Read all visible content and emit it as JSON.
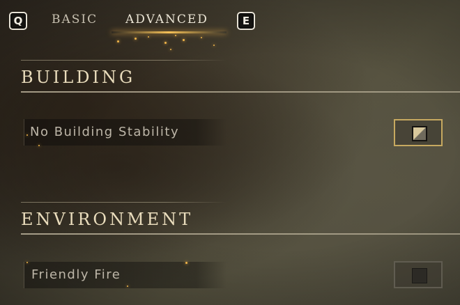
{
  "tabs": {
    "prev_key": "Q",
    "next_key": "E",
    "items": [
      {
        "label": "BASIC",
        "active": false
      },
      {
        "label": "ADVANCED",
        "active": true
      }
    ]
  },
  "sections": [
    {
      "title": "BUILDING",
      "settings": [
        {
          "label": "No Building Stability",
          "checked": true
        }
      ]
    },
    {
      "title": "ENVIRONMENT",
      "settings": [
        {
          "label": "Friendly Fire",
          "checked": false
        }
      ]
    }
  ],
  "colors": {
    "accent_gold": "#c7a960",
    "header_text": "#e9dcbc",
    "label_text": "#bdb6a8"
  }
}
